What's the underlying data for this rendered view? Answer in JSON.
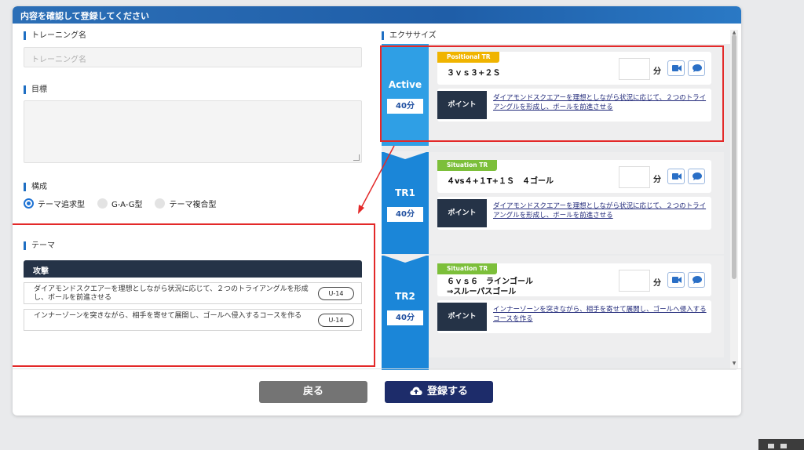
{
  "modal": {
    "title": "内容を確認して登録してください"
  },
  "left": {
    "training_name_label": "トレーニング名",
    "training_name_placeholder": "トレーニング名",
    "goal_label": "目標",
    "structure_label": "構成",
    "radios": [
      {
        "label": "テーマ追求型",
        "selected": true
      },
      {
        "label": "G-A-G型",
        "selected": false
      },
      {
        "label": "テーマ複合型",
        "selected": false
      }
    ],
    "theme_label": "テーマ",
    "theme_category": "攻撃",
    "theme_rows": [
      {
        "text": "ダイアモンドスクエアーを理想としながら状況に応じて、２つのトライアングルを形成し、ボールを前進させる",
        "badge": "U-14"
      },
      {
        "text": "インナーゾーンを突きながら、相手を寄せて展開し、ゴールへ侵入するコースを作る",
        "badge": "U-14"
      }
    ]
  },
  "right": {
    "exercise_label": "エクササイズ",
    "minute_unit": "分",
    "point_label": "ポイント",
    "cards": [
      {
        "stage": "Active",
        "time": "40分",
        "tag": "Positional TR",
        "tag_color": "#f0b400",
        "exercise": "３ｖｓ３+２Ｓ",
        "point": "ダイアモンドスクエアーを理想としながら状況に応じて、２つのトライアングルを形成し、ボールを前進させる",
        "stage_color": "#2f9fe5"
      },
      {
        "stage": "TR1",
        "time": "40分",
        "tag": "Situation TR",
        "tag_color": "#7cbf3a",
        "exercise": "４vs４+１T+１Ｓ　４ゴール",
        "point": "ダイアモンドスクエアーを理想としながら状況に応じて、２つのトライアングルを形成し、ボールを前進させる",
        "stage_color": "#1b86d8"
      },
      {
        "stage": "TR2",
        "time": "40分",
        "tag": "Situation TR",
        "tag_color": "#7cbf3a",
        "exercise": "６ｖｓ６　ラインゴール\n⇒スルーパスゴール",
        "point": "インナーゾーンを突きながら、相手を寄せて展開し、ゴールへ侵入するコースを作る",
        "stage_color": "#1b86d8"
      }
    ]
  },
  "footer": {
    "back_label": "戻る",
    "register_label": "登録する"
  },
  "colors": {
    "header": "#1f5ea8",
    "accent": "#1f6fc3",
    "navy": "#253347",
    "highlight": "#e32929"
  }
}
